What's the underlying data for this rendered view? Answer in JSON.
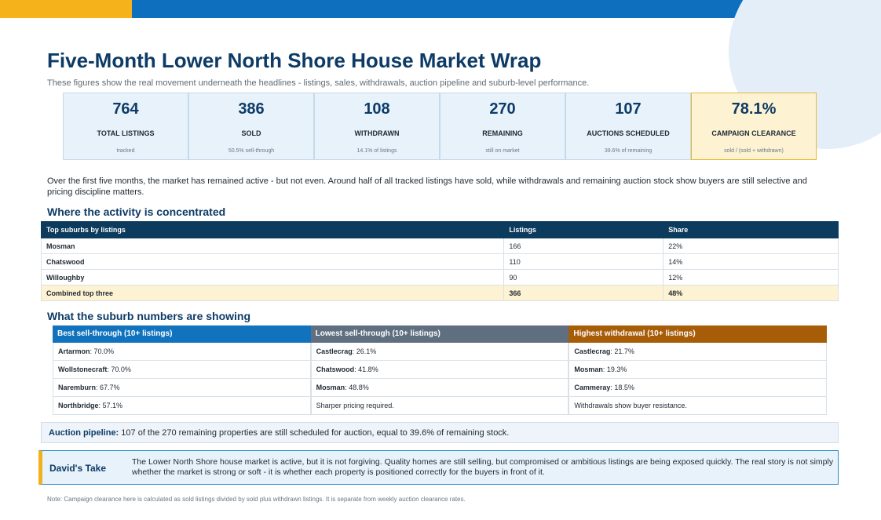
{
  "title": "Five-Month Lower North Shore House Market Wrap",
  "subtitle": "These figures show the real movement underneath the headlines - listings, sales, withdrawals, auction pipeline and suburb-level performance.",
  "kpis": [
    {
      "value": "764",
      "label": "TOTAL LISTINGS",
      "sub": "tracked"
    },
    {
      "value": "386",
      "label": "SOLD",
      "sub": "50.5% sell-through"
    },
    {
      "value": "108",
      "label": "WITHDRAWN",
      "sub": "14.1% of listings"
    },
    {
      "value": "270",
      "label": "REMAINING",
      "sub": "still on market"
    },
    {
      "value": "107",
      "label": "AUCTIONS SCHEDULED",
      "sub": "39.6% of remaining"
    },
    {
      "value": "78.1%",
      "label": "CAMPAIGN CLEARANCE",
      "sub": "sold / (sold + withdrawn)"
    }
  ],
  "intro": "Over the first five months, the market has remained active - but not even. Around half of all tracked listings have sold, while withdrawals and remaining auction stock show buyers are still selective and pricing discipline matters.",
  "activity": {
    "heading": "Where the activity is concentrated",
    "headers": [
      "Top suburbs by listings",
      "Listings",
      "Share"
    ],
    "rows": [
      [
        "Mosman",
        "166",
        "22%"
      ],
      [
        "Chatswood",
        "110",
        "14%"
      ],
      [
        "Willoughby",
        "90",
        "12%"
      ],
      [
        "Combined top three",
        "366",
        "48%"
      ]
    ]
  },
  "suburbs": {
    "heading": "What the suburb numbers are showing",
    "columns": [
      {
        "title": "Best sell-through (10+ listings)",
        "items": [
          {
            "name": "Artarmon",
            "value": ": 70.0%"
          },
          {
            "name": "Wollstonecraft",
            "value": ": 70.0%"
          },
          {
            "name": "Naremburn",
            "value": ": 67.7%"
          },
          {
            "name": "Northbridge",
            "value": ": 57.1%"
          }
        ]
      },
      {
        "title": "Lowest sell-through (10+ listings)",
        "items": [
          {
            "name": "Castlecrag",
            "value": ": 26.1%"
          },
          {
            "name": "Chatswood",
            "value": ": 41.8%"
          },
          {
            "name": "Mosman",
            "value": ": 48.8%"
          },
          {
            "name": "",
            "value": "Sharper pricing required."
          }
        ]
      },
      {
        "title": "Highest withdrawal (10+ listings)",
        "items": [
          {
            "name": "Castlecrag",
            "value": ": 21.7%"
          },
          {
            "name": "Mosman",
            "value": ": 19.3%"
          },
          {
            "name": "Cammeray",
            "value": ": 18.5%"
          },
          {
            "name": "",
            "value": "Withdrawals show buyer resistance."
          }
        ]
      }
    ]
  },
  "pipeline": {
    "label": "Auction pipeline:",
    "text": " 107 of the 270 remaining properties are still scheduled for auction, equal to 39.6% of remaining stock."
  },
  "take": {
    "label": "David's Take",
    "text": "The Lower North Shore house market is active, but it is not forgiving. Quality homes are still selling, but compromised or ambitious listings are being exposed quickly. The real story is not simply whether the market is strong or soft - it is whether each property is positioned correctly for the buyers in front of it."
  },
  "note": "Note: Campaign clearance here is calculated as sold listings divided by sold plus withdrawn listings. It is separate from weekly auction clearance rates.",
  "colors": {
    "brand_blue": "#0f6fbf",
    "accent_gold": "#f6b21a",
    "navy": "#0d3b66",
    "best_header": "#1173bd",
    "lowest_header": "#5f6f80",
    "withdrawal_header": "#a75c08"
  }
}
